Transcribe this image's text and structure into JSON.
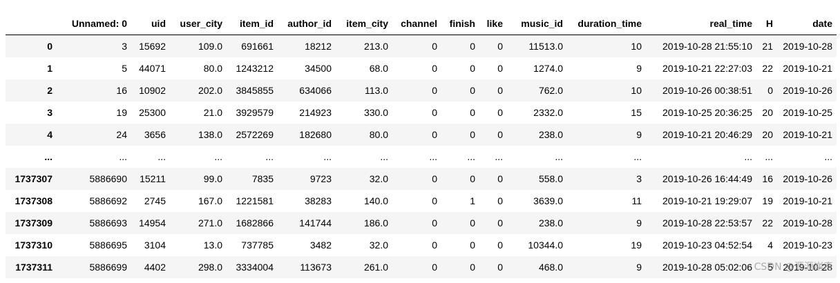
{
  "columns": [
    "",
    "Unnamed: 0",
    "uid",
    "user_city",
    "item_id",
    "author_id",
    "item_city",
    "channel",
    "finish",
    "like",
    "music_id",
    "duration_time",
    "real_time",
    "H",
    "date"
  ],
  "rows": [
    {
      "index": "0",
      "cells": [
        "3",
        "15692",
        "109.0",
        "691661",
        "18212",
        "213.0",
        "0",
        "0",
        "0",
        "11513.0",
        "10",
        "2019-10-28 21:55:10",
        "21",
        "2019-10-28"
      ]
    },
    {
      "index": "1",
      "cells": [
        "5",
        "44071",
        "80.0",
        "1243212",
        "34500",
        "68.0",
        "0",
        "0",
        "0",
        "1274.0",
        "9",
        "2019-10-21 22:27:03",
        "22",
        "2019-10-21"
      ]
    },
    {
      "index": "2",
      "cells": [
        "16",
        "10902",
        "202.0",
        "3845855",
        "634066",
        "113.0",
        "0",
        "0",
        "0",
        "762.0",
        "10",
        "2019-10-26 00:38:51",
        "0",
        "2019-10-26"
      ]
    },
    {
      "index": "3",
      "cells": [
        "19",
        "25300",
        "21.0",
        "3929579",
        "214923",
        "330.0",
        "0",
        "0",
        "0",
        "2332.0",
        "15",
        "2019-10-25 20:36:25",
        "20",
        "2019-10-25"
      ]
    },
    {
      "index": "4",
      "cells": [
        "24",
        "3656",
        "138.0",
        "2572269",
        "182680",
        "80.0",
        "0",
        "0",
        "0",
        "238.0",
        "9",
        "2019-10-21 20:46:29",
        "20",
        "2019-10-21"
      ]
    },
    {
      "index": "...",
      "cells": [
        "...",
        "...",
        "...",
        "...",
        "...",
        "...",
        "...",
        "...",
        "...",
        "...",
        "...",
        "...",
        "...",
        "..."
      ]
    },
    {
      "index": "1737307",
      "cells": [
        "5886690",
        "15211",
        "99.0",
        "7835",
        "9723",
        "32.0",
        "0",
        "0",
        "0",
        "558.0",
        "3",
        "2019-10-26 16:44:49",
        "16",
        "2019-10-26"
      ]
    },
    {
      "index": "1737308",
      "cells": [
        "5886692",
        "2745",
        "167.0",
        "1221581",
        "38283",
        "140.0",
        "0",
        "1",
        "0",
        "3639.0",
        "11",
        "2019-10-21 19:29:07",
        "19",
        "2019-10-21"
      ]
    },
    {
      "index": "1737309",
      "cells": [
        "5886693",
        "14954",
        "271.0",
        "1682866",
        "141744",
        "186.0",
        "0",
        "0",
        "0",
        "238.0",
        "9",
        "2019-10-28 22:53:57",
        "22",
        "2019-10-28"
      ]
    },
    {
      "index": "1737310",
      "cells": [
        "5886695",
        "3104",
        "13.0",
        "737785",
        "3482",
        "32.0",
        "0",
        "0",
        "0",
        "10344.0",
        "19",
        "2019-10-23 04:52:54",
        "4",
        "2019-10-23"
      ]
    },
    {
      "index": "1737311",
      "cells": [
        "5886699",
        "4402",
        "298.0",
        "3334004",
        "113673",
        "261.0",
        "0",
        "0",
        "0",
        "468.0",
        "9",
        "2019-10-28 05:02:06",
        "5",
        "2019-10-28"
      ]
    }
  ],
  "watermark": "CSDN @源源崩奇"
}
